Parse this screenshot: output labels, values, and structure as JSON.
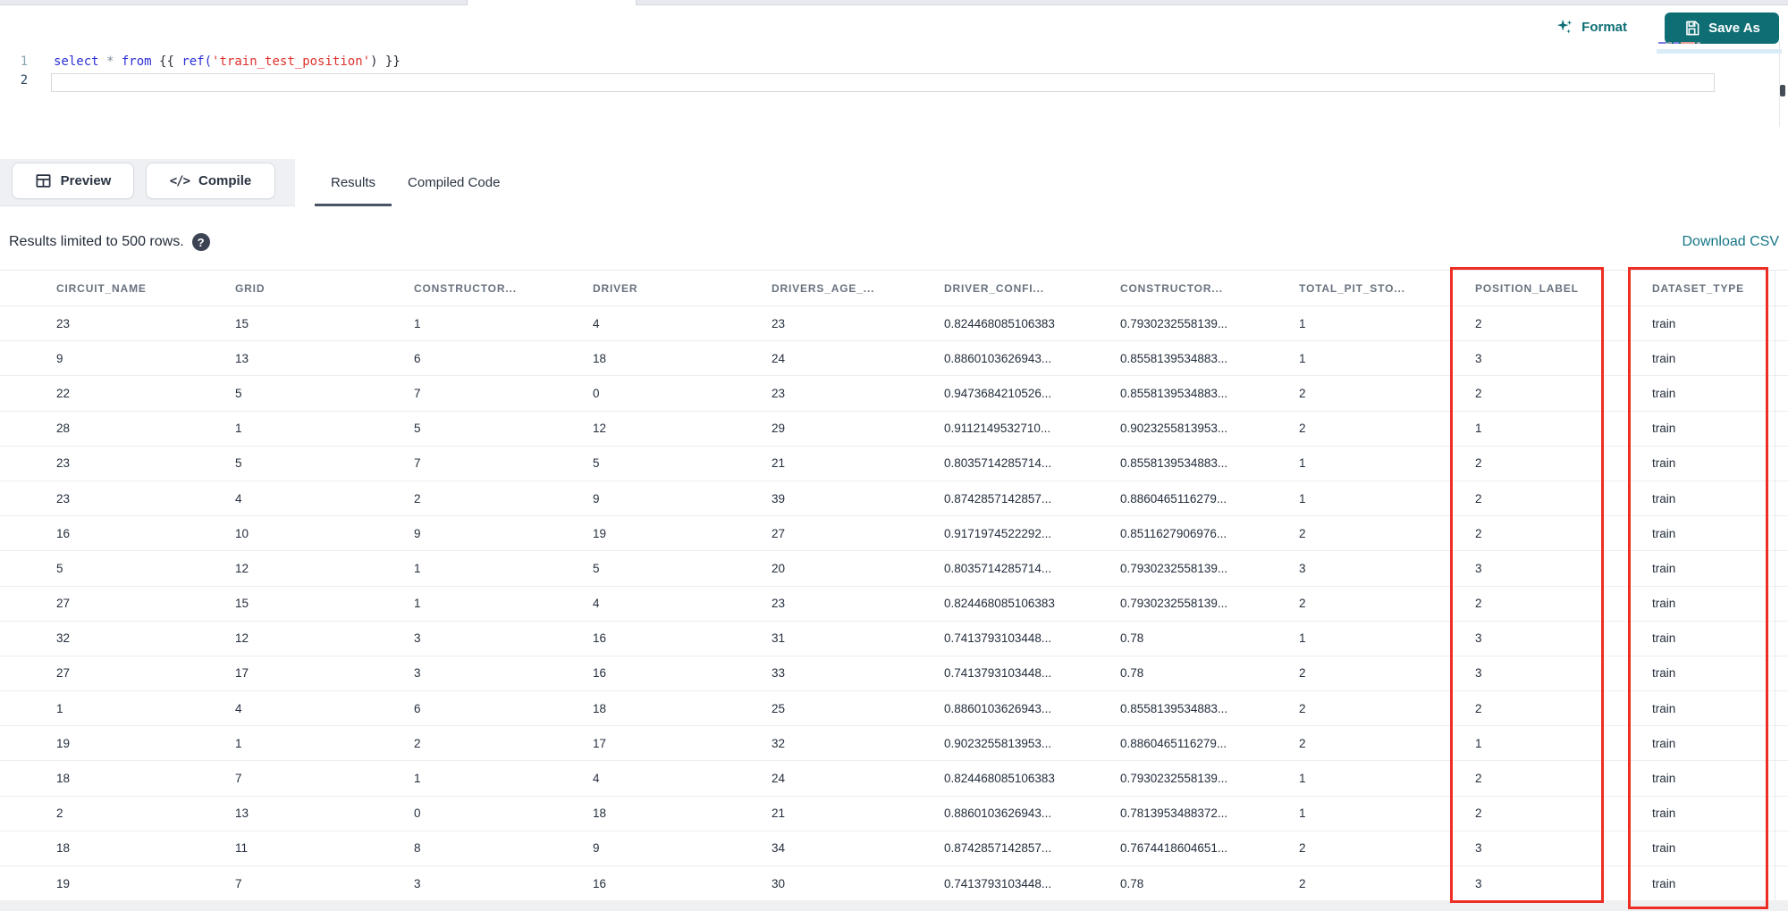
{
  "editor": {
    "line_numbers": [
      "1",
      "2"
    ],
    "code_tokens": [
      {
        "t": "kw",
        "v": "select "
      },
      {
        "t": "op",
        "v": "* "
      },
      {
        "t": "kw",
        "v": "from "
      },
      {
        "t": "brace",
        "v": "{{ "
      },
      {
        "t": "fn",
        "v": "ref("
      },
      {
        "t": "str",
        "v": "'train_test_position'"
      },
      {
        "t": "plain",
        "v": ") }}"
      }
    ],
    "format_label": "Format",
    "save_as_label": "Save As"
  },
  "toolbar": {
    "preview_label": "Preview",
    "compile_label": "Compile",
    "compile_icon_glyph": "</>",
    "tabs": [
      {
        "label": "Results",
        "active": true
      },
      {
        "label": "Compiled Code",
        "active": false
      }
    ]
  },
  "results_bar": {
    "limit_text": "Results limited to 500 rows.",
    "help_glyph": "?",
    "download_label": "Download CSV"
  },
  "table": {
    "columns": [
      "CIRCUIT_NAME",
      "GRID",
      "CONSTRUCTOR...",
      "DRIVER",
      "DRIVERS_AGE_...",
      "DRIVER_CONFI...",
      "CONSTRUCTOR...",
      "TOTAL_PIT_STO...",
      "POSITION_LABEL",
      "DATASET_TYPE"
    ],
    "rows": [
      [
        "23",
        "15",
        "1",
        "4",
        "23",
        "0.824468085106383",
        "0.7930232558139...",
        "1",
        "2",
        "train"
      ],
      [
        "9",
        "13",
        "6",
        "18",
        "24",
        "0.8860103626943...",
        "0.8558139534883...",
        "1",
        "3",
        "train"
      ],
      [
        "22",
        "5",
        "7",
        "0",
        "23",
        "0.9473684210526...",
        "0.8558139534883...",
        "2",
        "2",
        "train"
      ],
      [
        "28",
        "1",
        "5",
        "12",
        "29",
        "0.9112149532710...",
        "0.9023255813953...",
        "2",
        "1",
        "train"
      ],
      [
        "23",
        "5",
        "7",
        "5",
        "21",
        "0.8035714285714...",
        "0.8558139534883...",
        "1",
        "2",
        "train"
      ],
      [
        "23",
        "4",
        "2",
        "9",
        "39",
        "0.8742857142857...",
        "0.8860465116279...",
        "1",
        "2",
        "train"
      ],
      [
        "16",
        "10",
        "9",
        "19",
        "27",
        "0.9171974522292...",
        "0.8511627906976...",
        "2",
        "2",
        "train"
      ],
      [
        "5",
        "12",
        "1",
        "5",
        "20",
        "0.8035714285714...",
        "0.7930232558139...",
        "3",
        "3",
        "train"
      ],
      [
        "27",
        "15",
        "1",
        "4",
        "23",
        "0.824468085106383",
        "0.7930232558139...",
        "2",
        "2",
        "train"
      ],
      [
        "32",
        "12",
        "3",
        "16",
        "31",
        "0.7413793103448...",
        "0.78",
        "1",
        "3",
        "train"
      ],
      [
        "27",
        "17",
        "3",
        "16",
        "33",
        "0.7413793103448...",
        "0.78",
        "2",
        "3",
        "train"
      ],
      [
        "1",
        "4",
        "6",
        "18",
        "25",
        "0.8860103626943...",
        "0.8558139534883...",
        "2",
        "2",
        "train"
      ],
      [
        "19",
        "1",
        "2",
        "17",
        "32",
        "0.9023255813953...",
        "0.8860465116279...",
        "2",
        "1",
        "train"
      ],
      [
        "18",
        "7",
        "1",
        "4",
        "24",
        "0.824468085106383",
        "0.7930232558139...",
        "1",
        "2",
        "train"
      ],
      [
        "2",
        "13",
        "0",
        "18",
        "21",
        "0.8860103626943...",
        "0.7813953488372...",
        "1",
        "2",
        "train"
      ],
      [
        "18",
        "11",
        "8",
        "9",
        "34",
        "0.8742857142857...",
        "0.7674418604651...",
        "2",
        "3",
        "train"
      ],
      [
        "19",
        "7",
        "3",
        "16",
        "30",
        "0.7413793103448...",
        "0.78",
        "2",
        "3",
        "train"
      ]
    ],
    "annotated_columns": [
      "POSITION_LABEL",
      "DATASET_TYPE"
    ]
  },
  "colors": {
    "accent_teal": "#0e6e74",
    "annotation_red": "#ee2e24",
    "link_teal": "#147585",
    "string_red": "#dd332e",
    "keyword_blue": "#2d31d5"
  }
}
